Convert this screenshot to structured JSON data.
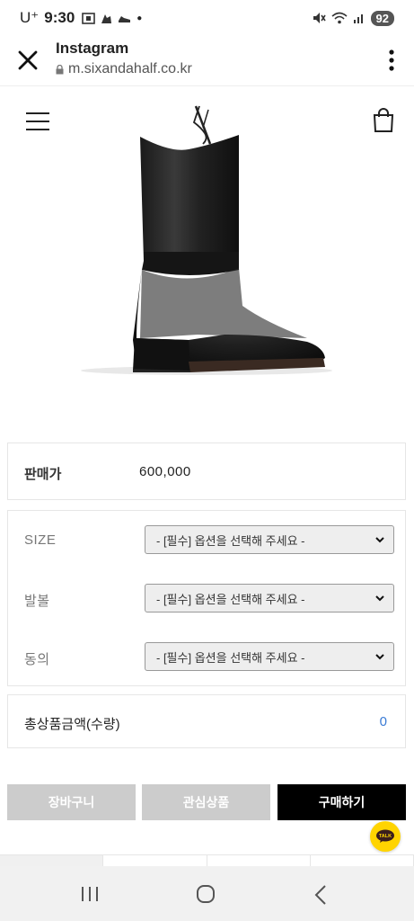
{
  "status": {
    "carrier": "U⁺",
    "time": "9:30",
    "battery": "92"
  },
  "browser": {
    "title": "Instagram",
    "url": "m.sixandahalf.co.kr"
  },
  "product": {
    "price_label": "판매가",
    "price_value": "600,000"
  },
  "options": [
    {
      "label": "SIZE",
      "selected": "- [필수] 옵션을 선택해 주세요 -"
    },
    {
      "label": "발볼",
      "selected": "- [필수] 옵션을 선택해 주세요 -"
    },
    {
      "label": "동의",
      "selected": "- [필수] 옵션을 선택해 주세요 -"
    }
  ],
  "total": {
    "label": "총상품금액(수량)",
    "value": "0",
    "value_color": "#3a7bd5"
  },
  "actions": {
    "cart": "장바구니",
    "wishlist": "관심상품",
    "buy": "구매하기"
  },
  "kakao": {
    "label": "TALK",
    "color": "#ffd400"
  },
  "icons": {
    "close": "close-icon",
    "lock": "lock-icon",
    "more": "kebab-menu-icon",
    "menu": "hamburger-icon",
    "cart": "shopping-bag-icon"
  }
}
